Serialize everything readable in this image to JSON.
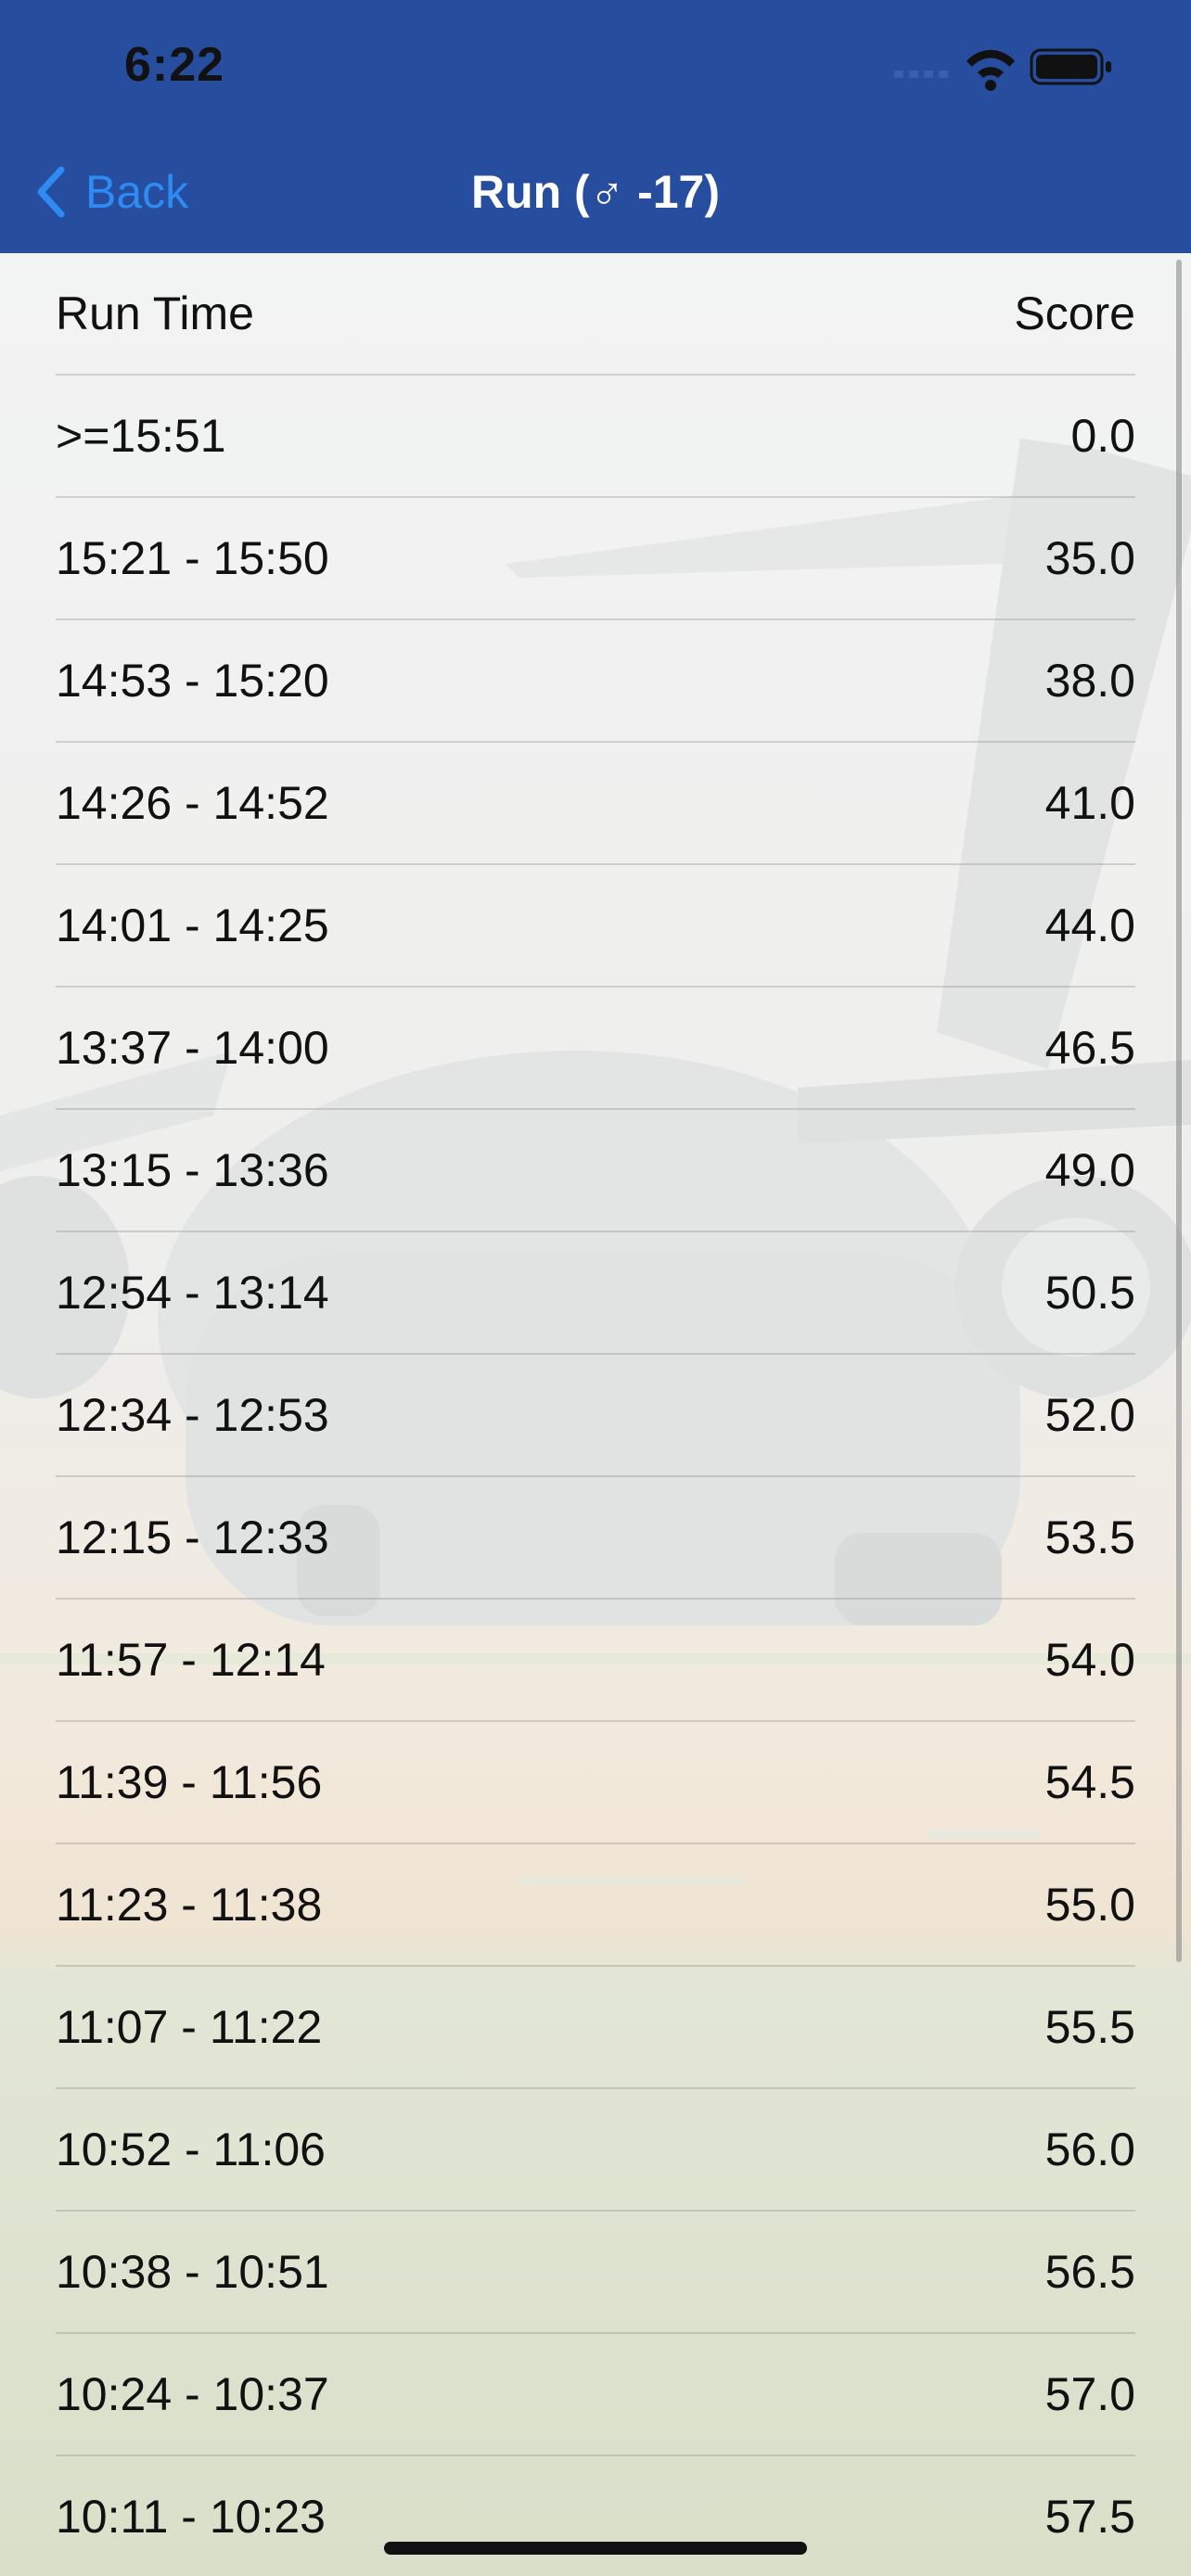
{
  "status_bar": {
    "time": "6:22"
  },
  "nav": {
    "back_label": "Back",
    "title": "Run (♂ -17)"
  },
  "table": {
    "header": {
      "left": "Run Time",
      "right": "Score"
    },
    "rows": [
      {
        "time": ">=15:51",
        "score": "0.0"
      },
      {
        "time": "15:21 - 15:50",
        "score": "35.0"
      },
      {
        "time": "14:53 - 15:20",
        "score": "38.0"
      },
      {
        "time": "14:26 - 14:52",
        "score": "41.0"
      },
      {
        "time": "14:01 - 14:25",
        "score": "44.0"
      },
      {
        "time": "13:37 - 14:00",
        "score": "46.5"
      },
      {
        "time": "13:15 - 13:36",
        "score": "49.0"
      },
      {
        "time": "12:54 - 13:14",
        "score": "50.5"
      },
      {
        "time": "12:34 - 12:53",
        "score": "52.0"
      },
      {
        "time": "12:15 - 12:33",
        "score": "53.5"
      },
      {
        "time": "11:57 - 12:14",
        "score": "54.0"
      },
      {
        "time": "11:39 - 11:56",
        "score": "54.5"
      },
      {
        "time": "11:23 - 11:38",
        "score": "55.0"
      },
      {
        "time": "11:07 - 11:22",
        "score": "55.5"
      },
      {
        "time": "10:52 - 11:06",
        "score": "56.0"
      },
      {
        "time": "10:38 - 10:51",
        "score": "56.5"
      },
      {
        "time": "10:24 - 10:37",
        "score": "57.0"
      },
      {
        "time": "10:11 - 10:23",
        "score": "57.5"
      }
    ]
  },
  "colors": {
    "header_bg": "#264d9e",
    "back_tint": "#2f8bf4",
    "text": "#111111"
  },
  "icons": {
    "back": "chevron-left-icon",
    "cellular": "cellular-signal-icon",
    "wifi": "wifi-icon",
    "battery": "battery-icon"
  }
}
